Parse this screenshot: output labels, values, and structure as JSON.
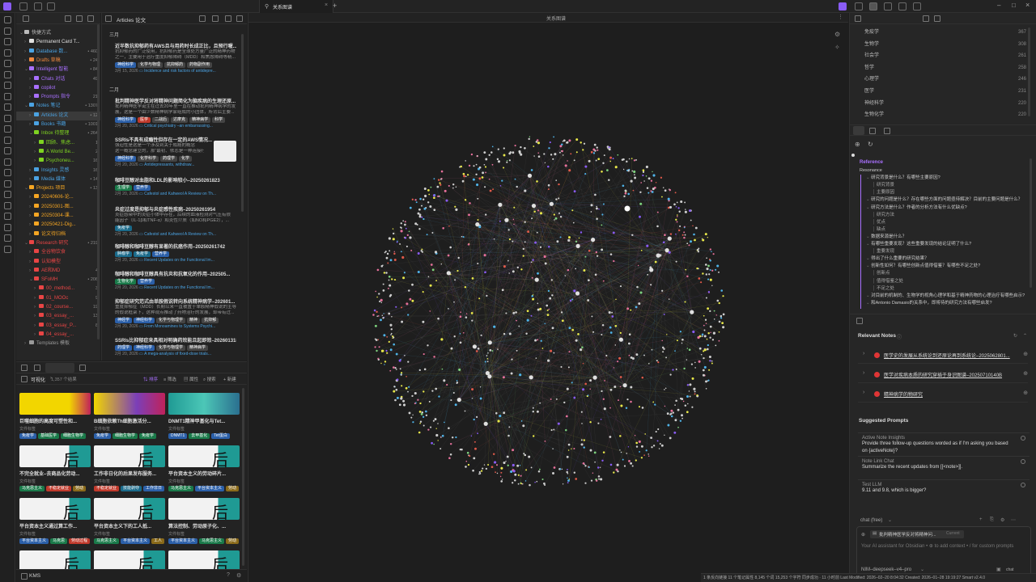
{
  "graph_tab": {
    "label": "关系图谱",
    "header": "关系图谱"
  },
  "explorer": {
    "items": [
      {
        "label": "快捷方式",
        "count": "",
        "color": "#bbbbbb",
        "indent": 1,
        "open": true
      },
      {
        "label": "Permanent Card T...",
        "count": "",
        "color": "#e0e0e0",
        "indent": 2,
        "open": false
      },
      {
        "label": "Database 数...",
        "count": "• 460",
        "color": "#4ba3e3",
        "indent": 2,
        "open": false
      },
      {
        "label": "Drafts 草稿",
        "count": "• 24",
        "color": "#f0883e",
        "indent": 2,
        "open": false
      },
      {
        "label": "Intelligent 智能",
        "count": "• 84",
        "color": "#a970ff",
        "indent": 2,
        "open": true
      },
      {
        "label": "Chats 对话",
        "count": "49",
        "color": "#a970ff",
        "indent": 3,
        "open": false
      },
      {
        "label": "copilot",
        "count": "",
        "color": "#a970ff",
        "indent": 3,
        "open": false
      },
      {
        "label": "Prompts 指令",
        "count": "21",
        "color": "#a970ff",
        "indent": 3,
        "open": false
      },
      {
        "label": "Notes 笔记",
        "count": "• 1307",
        "color": "#4ba3e3",
        "indent": 2,
        "open": true
      },
      {
        "label": "Articles 论文",
        "count": "• 12",
        "color": "#4ba3e3",
        "indent": 3,
        "open": false
      },
      {
        "label": "Books 书籍",
        "count": "• 1001",
        "color": "#4ba3e3",
        "indent": 3,
        "open": false
      },
      {
        "label": "Inbox 待整理",
        "count": "• 264",
        "color": "#7ed321",
        "indent": 3,
        "open": true
      },
      {
        "label": "回顾、焦虑...",
        "count": "1",
        "color": "#7ed321",
        "indent": 4,
        "open": false
      },
      {
        "label": "A World Be...",
        "count": "2",
        "color": "#7ed321",
        "indent": 4,
        "open": false
      },
      {
        "label": "Psychoneu...",
        "count": "16",
        "color": "#7ed321",
        "indent": 4,
        "open": false
      },
      {
        "label": "Insights 灵感",
        "count": "16",
        "color": "#4ba3e3",
        "indent": 3,
        "open": false
      },
      {
        "label": "Media 媒体",
        "count": "• 14",
        "color": "#4ba3e3",
        "indent": 3,
        "open": false
      },
      {
        "label": "Projects 项目",
        "count": "• 13",
        "color": "#f5a623",
        "indent": 2,
        "open": true
      },
      {
        "label": "20240606-论...",
        "count": "",
        "color": "#f5a623",
        "indent": 3,
        "open": false
      },
      {
        "label": "20250301-图...",
        "count": "",
        "color": "#f5a623",
        "indent": 3,
        "open": false
      },
      {
        "label": "20250304-课...",
        "count": "",
        "color": "#f5a623",
        "indent": 3,
        "open": false
      },
      {
        "label": "20250421-Dig...",
        "count": "",
        "color": "#f5a623",
        "indent": 3,
        "open": false
      },
      {
        "label": "论文待归档",
        "count": "",
        "color": "#f5a623",
        "indent": 3,
        "open": false
      },
      {
        "label": "Research 研究",
        "count": "• 219",
        "color": "#e84545",
        "indent": 2,
        "open": true
      },
      {
        "label": "全谷物饮食",
        "count": "",
        "color": "#e84545",
        "indent": 3,
        "open": false
      },
      {
        "label": "认知模型",
        "count": "",
        "color": "#e84545",
        "indent": 3,
        "open": false
      },
      {
        "label": "AE和MD",
        "count": "4",
        "color": "#e84545",
        "indent": 3,
        "open": false
      },
      {
        "label": "SFoMH",
        "count": "• 206",
        "color": "#e84545",
        "indent": 3,
        "open": true
      },
      {
        "label": "00_method...",
        "count": "3",
        "color": "#e84545",
        "indent": 4,
        "open": false
      },
      {
        "label": "01_MOOc",
        "count": "9",
        "color": "#e84545",
        "indent": 4,
        "open": false
      },
      {
        "label": "02_course...",
        "count": "19",
        "color": "#e84545",
        "indent": 4,
        "open": false
      },
      {
        "label": "03_essay_...",
        "count": "13",
        "color": "#e84545",
        "indent": 4,
        "open": false
      },
      {
        "label": "03_essay_P...",
        "count": "8",
        "color": "#e84545",
        "indent": 4,
        "open": false
      },
      {
        "label": "04_essay_...",
        "count": "",
        "color": "#e84545",
        "indent": 4,
        "open": false
      },
      {
        "label": "Templates 模板",
        "count": "",
        "color": "#999999",
        "indent": 2,
        "open": false
      }
    ]
  },
  "articles": {
    "header": "Articles 论文",
    "months": [
      "三月",
      "二月"
    ],
    "cards": [
      {
        "title": "近半数抗抑郁药有AWS且与用药时长成正比，且预行喔...",
        "body": [
          "抗抑郁药的广泛使用，抗抑郁药是全球处方量广泛的精神药物",
          "之一，主要用于治疗重度抑郁障碍（MDD）和焦虑障碍等精..."
        ],
        "tags": [
          {
            "t": "神经科学",
            "c": "#2b5fa8"
          },
          {
            "t": "化学与物理",
            "c": "#444"
          },
          {
            "t": "抗抑郁药",
            "c": "#444"
          },
          {
            "t": "药物副作用",
            "c": "#444"
          }
        ],
        "date": "3月 15, 2026",
        "link": "Incidence and risk factors of antidepre..."
      },
      {
        "title": "批判精神医学反对将精神问题简化为脑疾病的生理还原...",
        "body": [
          "批判精神医学诞生在过去20年里一直在推动批判精神病学的发",
          "展，这是一个由少数精神病学家组成的小团体，所背后主要..."
        ],
        "tags": [
          {
            "t": "神经科学",
            "c": "#2b5fa8"
          },
          {
            "t": "医学",
            "c": "#c0392b"
          },
          {
            "t": "二战后",
            "c": "#444"
          },
          {
            "t": "达摩克",
            "c": "#444"
          },
          {
            "t": "精神病学",
            "c": "#444"
          },
          {
            "t": "科学",
            "c": "#444"
          }
        ],
        "date": "2月 20, 2026",
        "link": "Critical psychiatry –an embarrassing..."
      },
      {
        "title": "SSRIs不具有成瘾性但存在一定的AWS情况...",
        "body": [
          "强迫性是这是一个涉及到关于成瘾的概念",
          "这一概念建立的，那“最初、依恋是一种连接行..."
        ],
        "tags": [
          {
            "t": "神经科学",
            "c": "#2b5fa8"
          },
          {
            "t": "化学科学",
            "c": "#444"
          },
          {
            "t": "药理学",
            "c": "#444"
          },
          {
            "t": "化学",
            "c": "#444"
          }
        ],
        "date": "2月 20, 2026",
        "link": "Antidepressants, withdraw..."
      },
      {
        "title": "咖啡豆醇对血脂和LDL的影响较小–20250261823",
        "body": [],
        "tags": [
          {
            "t": "生理学",
            "c": "#1a7a4a"
          },
          {
            "t": "营养学",
            "c": "#2b5fa8"
          }
        ],
        "date": "2月 20, 2026",
        "link": "Cafestol and Kahweol A Review on Th..."
      },
      {
        "title": "炎症过度是抑郁与炎症感性疾病–20250261954",
        "body": [
          "炎症感染中的炎症小体中存在，后续的血液检测对气压有很",
          "能因子（IL-1β和TNF-α）和炎性介质（如NO和PGE2），..."
        ],
        "tags": [
          {
            "t": "免疫学",
            "c": "#1a6a8a"
          }
        ],
        "date": "2月 20, 2026",
        "link": "Cafestol and Kahweol A Review on Th..."
      },
      {
        "title": "咖啡醇和咖啡豆醇有显著的抗癌作用–20250261742",
        "body": [],
        "tags": [
          {
            "t": "肿瘤学",
            "c": "#1a6a8a"
          },
          {
            "t": "免疫学",
            "c": "#1a6a8a"
          },
          {
            "t": "营养学",
            "c": "#2b5fa8"
          }
        ],
        "date": "2月 20, 2026",
        "link": "Recent Updates on the Functional Im..."
      },
      {
        "title": "咖啡醇和咖啡豆醇具有抗炎和抗氧化的作用–202505...",
        "body": [],
        "tags": [
          {
            "t": "生物化学",
            "c": "#1a7a4a"
          },
          {
            "t": "营养学",
            "c": "#2b5fa8"
          }
        ],
        "date": "2月 20, 2026",
        "link": "Recent Updates on the Functional Im..."
      },
      {
        "title": "抑郁症研究范式由单胺假说转向系统精神病学–202601...",
        "body": [
          "重度抑郁症（MDD）长期以来一直被置于单胺精神假说的主导",
          "的假说框架下，这种观点推动了药物治疗的发展，却带有过..."
        ],
        "tags": [
          {
            "t": "神经学",
            "c": "#2b5fa8"
          },
          {
            "t": "神经科学",
            "c": "#2b5fa8"
          },
          {
            "t": "化学与物理学",
            "c": "#444"
          },
          {
            "t": "精神",
            "c": "#444"
          },
          {
            "t": "抗抑郁",
            "c": "#444"
          }
        ],
        "date": "2月 20, 2026",
        "link": "From Monoamines to Systems Psychi..."
      },
      {
        "title": "SSRIs比抑郁症来具相对明确药效能且起即效–20260131829",
        "body": [],
        "tags": [
          {
            "t": "药理学",
            "c": "#2b5fa8"
          },
          {
            "t": "神经科学",
            "c": "#2b5fa8"
          },
          {
            "t": "化学与物理学",
            "c": "#444"
          },
          {
            "t": "精神病学",
            "c": "#444"
          }
        ],
        "date": "2月 20, 2026",
        "link": "A mega-analysis of fixed-dose trials..."
      }
    ]
  },
  "bottom": {
    "view_label": "可视化",
    "count_label": "1,357 个结果",
    "tools": [
      "排序",
      "筛选",
      "属性",
      "搜索",
      "新建"
    ],
    "cards": [
      {
        "title": "巨噬细胞的高度可塑性和...",
        "sub": "文件标签",
        "tags": [
          {
            "t": "免疫学",
            "c": "#2b5fa8"
          },
          {
            "t": "基础医学",
            "c": "#1a7a4a"
          },
          {
            "t": "细胞生物学",
            "c": "#1a7a4a"
          }
        ],
        "thumb": "yellow"
      },
      {
        "title": "B细胞依赖Th细胞激活分...",
        "sub": "文件标签",
        "tags": [
          {
            "t": "免疫学",
            "c": "#2b5fa8"
          },
          {
            "t": "细胞生物学",
            "c": "#1a7a4a"
          },
          {
            "t": "免疫学",
            "c": "#1a7a4a"
          }
        ],
        "thumb": "purple"
      },
      {
        "title": "DNMT1精神甲基化与Tet...",
        "sub": "文件标签",
        "tags": [
          {
            "t": "DNMT1",
            "c": "#2b5fa8"
          },
          {
            "t": "去甲基化",
            "c": "#1a7a4a"
          },
          {
            "t": "Tet蛋白",
            "c": "#2b5fa8"
          }
        ],
        "thumb": "teal"
      },
      {
        "title": "不完全就业–去商品化劳动...",
        "sub": "文件标签",
        "tags": [
          {
            "t": "马克思主义",
            "c": "#1a7a4a"
          },
          {
            "t": "不稳定就业",
            "c": "#c0392b"
          },
          {
            "t": "劳动",
            "c": "#8a6a1a"
          }
        ],
        "thumb": "white"
      },
      {
        "title": "工作非日化的后果发布服务...",
        "sub": "文件标签",
        "tags": [
          {
            "t": "不稳定就业",
            "c": "#c0392b"
          },
          {
            "t": "技能剥夺",
            "c": "#1a6a8a"
          },
          {
            "t": "工作非日",
            "c": "#2b5fa8"
          }
        ],
        "thumb": "white"
      },
      {
        "title": "平台资本主义的劳动碎片...",
        "sub": "文件标签",
        "tags": [
          {
            "t": "马克思主义",
            "c": "#1a7a4a"
          },
          {
            "t": "平台资本主义",
            "c": "#2b5fa8"
          },
          {
            "t": "劳动",
            "c": "#8a6a1a"
          }
        ],
        "thumb": "white"
      },
      {
        "title": "平台资本主义通过算工作...",
        "sub": "文件标签",
        "tags": [
          {
            "t": "平台资本主义",
            "c": "#2b5fa8"
          },
          {
            "t": "马克思",
            "c": "#1a7a4a"
          },
          {
            "t": "劳动过程",
            "c": "#c0392b"
          }
        ],
        "thumb": "white"
      },
      {
        "title": "平台资本主义下的工人抵...",
        "sub": "文件标签",
        "tags": [
          {
            "t": "马克思主义",
            "c": "#1a7a4a"
          },
          {
            "t": "平台资本主义",
            "c": "#2b5fa8"
          },
          {
            "t": "工人",
            "c": "#8a6a1a"
          }
        ],
        "thumb": "white"
      },
      {
        "title": "算法控制、劳动原子化、...",
        "sub": "文件标签",
        "tags": [
          {
            "t": "平台资本主义",
            "c": "#2b5fa8"
          },
          {
            "t": "马克思主义",
            "c": "#1a7a4a"
          },
          {
            "t": "劳动",
            "c": "#8a6a1a"
          }
        ],
        "thumb": "white"
      },
      {
        "title": "",
        "sub": "",
        "tags": [],
        "thumb": "white"
      },
      {
        "title": "",
        "sub": "",
        "tags": [],
        "thumb": "white"
      },
      {
        "title": "",
        "sub": "",
        "tags": [],
        "thumb": "white"
      }
    ]
  },
  "kms_label": "KMS",
  "right": {
    "tag_stats": [
      {
        "name": "免疫学",
        "n": "367"
      },
      {
        "name": "生物学",
        "n": "308"
      },
      {
        "name": "社会学",
        "n": "261"
      },
      {
        "name": "哲学",
        "n": "258"
      },
      {
        "name": "心理学",
        "n": "246"
      },
      {
        "name": "医学",
        "n": "231"
      },
      {
        "name": "神经科学",
        "n": "220"
      },
      {
        "name": "生物化学",
        "n": "220"
      }
    ],
    "outline_title": "Reference",
    "outline": [
      {
        "t": "Resonance",
        "lvl": 0
      },
      {
        "t": "研究背景是什么？有哪些主要原因?",
        "lvl": 1
      },
      {
        "t": "研究背景",
        "lvl": 2
      },
      {
        "t": "主要原因",
        "lvl": 2
      },
      {
        "t": "研究的问题是什么？存在哪些方面的问题亟待解决？目前的主要问题是什么？",
        "lvl": 1
      },
      {
        "t": "研究方法是什么？作者的分析方法有什么优缺点?",
        "lvl": 1
      },
      {
        "t": "研究方法",
        "lvl": 2
      },
      {
        "t": "优点",
        "lvl": 2
      },
      {
        "t": "缺点",
        "lvl": 2
      },
      {
        "t": "数据来源是什么？",
        "lvl": 1
      },
      {
        "t": "有哪些重要发现？这些重要发现的结论证明了什么?",
        "lvl": 1
      },
      {
        "t": "重要发现",
        "lvl": 2
      },
      {
        "t": "得出了什么重要的研究结果？",
        "lvl": 1
      },
      {
        "t": "创新性如何？有哪些创新点值得借鉴？有哪些不足之处?",
        "lvl": 1
      },
      {
        "t": "创新点",
        "lvl": 2
      },
      {
        "t": "值得借鉴之处",
        "lvl": 2
      },
      {
        "t": "不足之处",
        "lvl": 2
      },
      {
        "t": "对目前的机制的、生物学的视角心理学和基于精神药物的心理治疗有哪些启示?",
        "lvl": 1
      },
      {
        "t": "和Antonio Damasio的关系中，即将待的研究方法有哪些启发?",
        "lvl": 1
      }
    ],
    "relevant_title": "Relevant Notes",
    "relevant": [
      "医学史的发展从系统论到还原论再到系统论–2025062801...",
      "医学对疾病本质的研究穿插于身识图谱–20250710140B",
      "精神病学的物研究"
    ],
    "suggested_title": "Suggested Prompts",
    "prompts": [
      {
        "t": "Active Note Insights",
        "d": "Provide three follow-up questions worded as if I'm asking you based on {activeNote}?"
      },
      {
        "t": "Note Link Chat",
        "d": "Summarize the recent updates from [[<note>]]."
      },
      {
        "t": "Test LLM",
        "d": "9.11 and 9.8, which is bigger?"
      }
    ],
    "chat_mode": "chat (free)",
    "context_chip": "批判精神医学反对将精神问...",
    "context_current": "Current",
    "chat_placeholder": "Your AI assistant for Obsidian • ⊕ to add context • / for custom prompts",
    "model": "NIM–deepseek–v4–pro",
    "send_label": "chat"
  },
  "status": {
    "text": "1 条反向链接    11 个笔记属性    8,145 个词   15,253 个字符    同步成功 · 11 小时前    Last Modified: 2026–02–20 8:04:32    Created: 2026–01–28 19:19:27    Smart v2.4.0"
  },
  "colors": {
    "blue": "#4ba3e3",
    "red": "#e03535",
    "purple": "#a970ff",
    "accent": "#8a5cf6"
  }
}
